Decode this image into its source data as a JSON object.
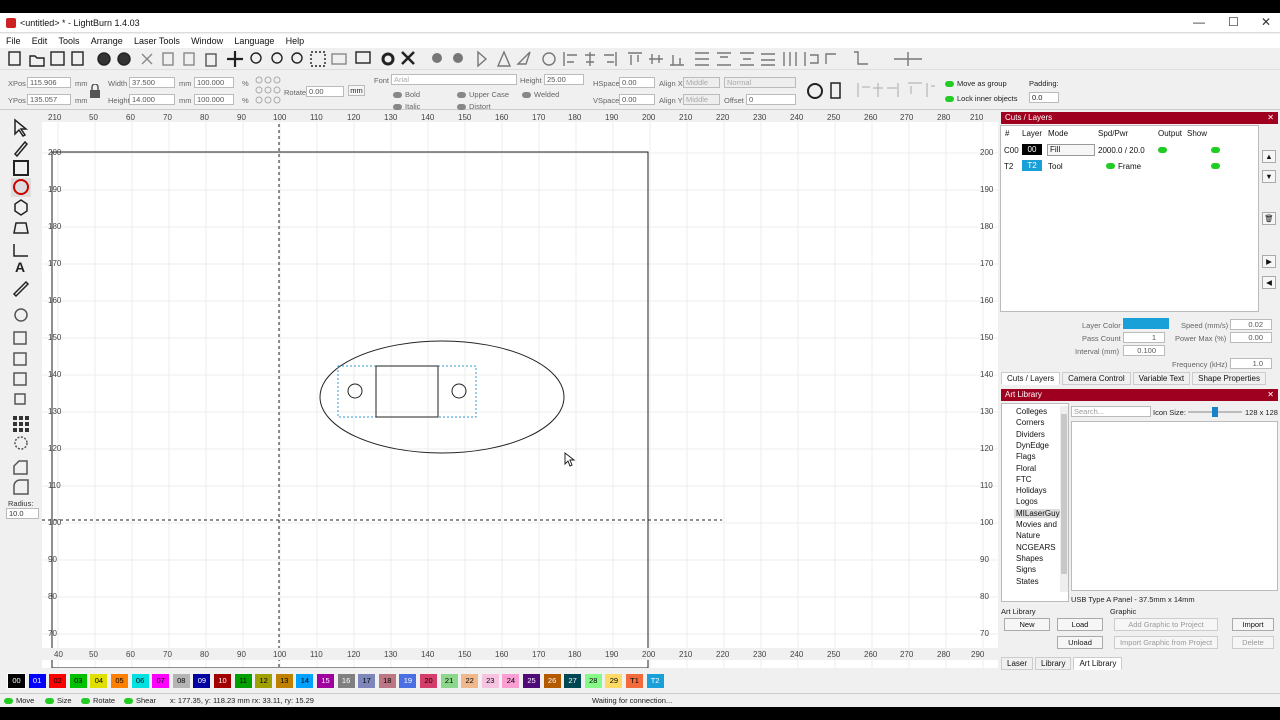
{
  "window": {
    "title": "<untitled> * - LightBurn 1.4.03",
    "min": "—",
    "max": "☐",
    "close": "✕"
  },
  "menu": [
    "File",
    "Edit",
    "Tools",
    "Arrange",
    "Laser Tools",
    "Window",
    "Language",
    "Help"
  ],
  "props": {
    "xpos_label": "XPos",
    "xpos": "115.906",
    "ypos_label": "YPos",
    "ypos": "135.057",
    "unit1": "mm",
    "unit2": "mm",
    "width_label": "Width",
    "width": "37.500",
    "height_label": "Height",
    "height": "14.000",
    "wpct": "100.000",
    "hpct": "100.000",
    "pct": "%",
    "rotate_label": "Rotate",
    "rotate": "0.00",
    "mm_btn": "mm",
    "font_label": "Font",
    "font": "Arial",
    "fheight_label": "Height",
    "fheight": "25.00",
    "hspace_label": "HSpace",
    "hspace": "0.00",
    "vspace_label": "VSpace",
    "vspace": "0.00",
    "alignx_label": "Align X",
    "alignx": "Middle",
    "aligny_label": "Align Y",
    "aligny": "Middle",
    "normal": "Normal",
    "offset_label": "Offset",
    "offset": "0",
    "bold": "Bold",
    "italic": "Italic",
    "upper": "Upper Case",
    "distort": "Distort",
    "welded": "Welded",
    "move_group": "Move as group",
    "lock_inner": "Lock inner objects",
    "padding_label": "Padding:",
    "padding": "0.0"
  },
  "ruler": {
    "top": [
      "210",
      "50",
      "60",
      "70",
      "80",
      "90",
      "100",
      "110",
      "120",
      "130",
      "140",
      "150",
      "160",
      "170",
      "180",
      "190",
      "200",
      "210",
      "220",
      "230",
      "240",
      "250",
      "260",
      "270",
      "280",
      "210"
    ],
    "left": [
      "200",
      "190",
      "180",
      "170",
      "160",
      "150",
      "140",
      "130",
      "120",
      "110",
      "100",
      "90",
      "80",
      "70"
    ],
    "right": [
      "200",
      "190",
      "180",
      "170",
      "160",
      "150",
      "140",
      "130",
      "120",
      "110",
      "100",
      "90",
      "80",
      "70"
    ],
    "bottom": [
      "40",
      "50",
      "60",
      "70",
      "80",
      "90",
      "100",
      "110",
      "120",
      "130",
      "140",
      "150",
      "160",
      "170",
      "180",
      "190",
      "200",
      "210",
      "220",
      "230",
      "240",
      "250",
      "260",
      "270",
      "280",
      "290"
    ]
  },
  "radius": {
    "label": "Radius:",
    "value": "10.0"
  },
  "palette": [
    "00",
    "01",
    "02",
    "03",
    "04",
    "05",
    "06",
    "07",
    "08",
    "09",
    "10",
    "11",
    "12",
    "13",
    "14",
    "15",
    "16",
    "17",
    "18",
    "19",
    "20",
    "21",
    "22",
    "23",
    "24",
    "25",
    "26",
    "27",
    "28",
    "29",
    "T1",
    "T2"
  ],
  "palette_colors": [
    "#000000",
    "#0000ff",
    "#ff0000",
    "#00c000",
    "#e0e000",
    "#ff8000",
    "#00e0e0",
    "#ff00ff",
    "#b4b4b4",
    "#0000a0",
    "#a00000",
    "#00a000",
    "#a0a000",
    "#c08000",
    "#00a0ff",
    "#a000a0",
    "#808080",
    "#7d87b9",
    "#bb7784",
    "#4a6fe3",
    "#d33f6a",
    "#8cd78c",
    "#f0b98d",
    "#f6c4e1",
    "#fa9ed4",
    "#500a78",
    "#b45a00",
    "#004754",
    "#86fa88",
    "#ffdb66",
    "#f36b3b",
    "#1aa0d8"
  ],
  "status": {
    "move": "Move",
    "size": "Size",
    "rotate": "Rotate",
    "shear": "Shear",
    "coords": "x: 177.35, y: 118.23 mm  rx: 33.11, ry: 15.29",
    "conn": "Waiting for connection..."
  },
  "cuts": {
    "title": "Cuts / Layers",
    "headers": [
      "#",
      "Layer",
      "Mode",
      "Spd/Pwr",
      "Output",
      "Show"
    ],
    "rows": [
      {
        "num": "C00",
        "layer": "00",
        "mode": "Fill",
        "spd": "2000.0 / 20.0",
        "color": "#000000"
      },
      {
        "num": "T2",
        "layer": "T2",
        "mode": "Tool",
        "spd": "Frame",
        "color": "#1aa0d8"
      }
    ],
    "layer_color_label": "Layer Color",
    "speed_label": "Speed (mm/s)",
    "speed": "0.02",
    "pass_label": "Pass Count",
    "pass": "1",
    "powermax_label": "Power Max (%)",
    "powermax": "0.00",
    "interval_label": "Interval (mm)",
    "interval": "0.100",
    "freq_label": "Frequency (kHz)",
    "freq": "1.0"
  },
  "tabs1": [
    "Cuts / Layers",
    "Camera Control",
    "Variable Text",
    "Shape Properties"
  ],
  "artlib": {
    "title": "Art Library",
    "items": [
      "Colleges",
      "Corners",
      "Dividers",
      "DynEdge",
      "Flags",
      "Floral",
      "FTC",
      "Holidays",
      "Logos",
      "MILaserGuy",
      "Movies and",
      "Nature",
      "NCGEARS",
      "Shapes",
      "Signs",
      "States"
    ],
    "search": "Search...",
    "iconsize_label": "Icon Size:",
    "iconsize": "128 x 128",
    "caption": "USB Type A Panel - 37.5mm x 14mm",
    "lib_label": "Art Library",
    "graphic_label": "Graphic",
    "new": "New",
    "load": "Load",
    "unload": "Unload",
    "add": "Add Graphic to Project",
    "import": "Import",
    "import_from": "Import Graphic from Project",
    "delete": "Delete"
  },
  "tabs2": [
    "Laser",
    "Library",
    "Art Library"
  ]
}
